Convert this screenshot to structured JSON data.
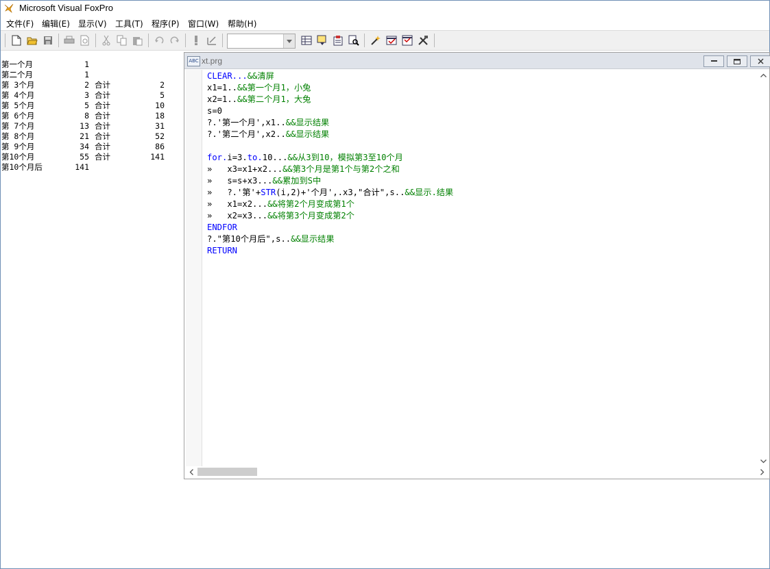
{
  "app": {
    "title": "Microsoft Visual FoxPro"
  },
  "menu": [
    "文件(F)",
    "编辑(E)",
    "显示(V)",
    "工具(T)",
    "程序(P)",
    "窗口(W)",
    "帮助(H)"
  ],
  "toolbar": {
    "icons": [
      "new-file-icon",
      "open-folder-icon",
      "save-icon",
      "print-icon",
      "print-preview-icon",
      "cut-icon",
      "copy-icon",
      "paste-icon",
      "undo-icon",
      "redo-icon",
      "run-icon",
      "modify-form-icon",
      "data-session-icon",
      "form-wizard-icon",
      "report-icon",
      "query-icon",
      "builder-icon",
      "properties-icon",
      "code-icon",
      "tools-icon"
    ],
    "combo_value": ""
  },
  "output": [
    [
      "第一个月",
      "1",
      "",
      ""
    ],
    [
      "第二个月",
      "1",
      "",
      ""
    ],
    [
      "第 3个月",
      "2",
      "合计",
      "2"
    ],
    [
      "第 4个月",
      "3",
      "合计",
      "5"
    ],
    [
      "第 5个月",
      "5",
      "合计",
      "10"
    ],
    [
      "第 6个月",
      "8",
      "合计",
      "18"
    ],
    [
      "第 7个月",
      "13",
      "合计",
      "31"
    ],
    [
      "第 8个月",
      "21",
      "合计",
      "52"
    ],
    [
      "第 9个月",
      "34",
      "合计",
      "86"
    ],
    [
      "第10个月",
      "55",
      "合计",
      "141"
    ],
    [
      "第10个月后",
      "141",
      "",
      ""
    ]
  ],
  "editor": {
    "filename": "xt.prg",
    "lines": [
      [
        [
          "kw",
          "CLEAR..."
        ],
        [
          "cm",
          "&&清屏"
        ]
      ],
      [
        [
          "",
          "x1=1.."
        ],
        [
          "cm",
          "&&第一个月1，小兔"
        ]
      ],
      [
        [
          "",
          "x2=1.."
        ],
        [
          "cm",
          "&&第二个月1，大兔"
        ]
      ],
      [
        [
          "",
          "s=0"
        ]
      ],
      [
        [
          "",
          "?.'第一个月',x1.."
        ],
        [
          "cm",
          "&&显示结果"
        ]
      ],
      [
        [
          "",
          "?.'第二个月',x2.."
        ],
        [
          "cm",
          "&&显示结果"
        ]
      ],
      [
        [
          "",
          ""
        ]
      ],
      [
        [
          "kw",
          "for."
        ],
        [
          "",
          "i=3."
        ],
        [
          "kw",
          "to."
        ],
        [
          "",
          "10..."
        ],
        [
          "cm",
          "&&从3到10，模拟第3至10个月"
        ]
      ],
      [
        [
          "",
          "»   x3=x1+x2..."
        ],
        [
          "cm",
          "&&第3个月是第1个与第2个之和"
        ]
      ],
      [
        [
          "",
          "»   s=s+x3..."
        ],
        [
          "cm",
          "&&累加到S中"
        ]
      ],
      [
        [
          "",
          "»   ?.'第'+"
        ],
        [
          "kw",
          "STR"
        ],
        [
          "",
          "(i,2)+'个月',.x3,\"合计\",s.."
        ],
        [
          "cm",
          "&&显示.结果"
        ]
      ],
      [
        [
          "",
          "»   x1=x2..."
        ],
        [
          "cm",
          "&&将第2个月变成第1个"
        ]
      ],
      [
        [
          "",
          "»   x2=x3..."
        ],
        [
          "cm",
          "&&将第3个月变成第2个"
        ]
      ],
      [
        [
          "kw",
          "ENDFOR"
        ]
      ],
      [
        [
          "",
          "?.\"第10个月后\",s.."
        ],
        [
          "cm",
          "&&显示结果"
        ]
      ],
      [
        [
          "kw",
          "RETURN"
        ]
      ]
    ]
  }
}
